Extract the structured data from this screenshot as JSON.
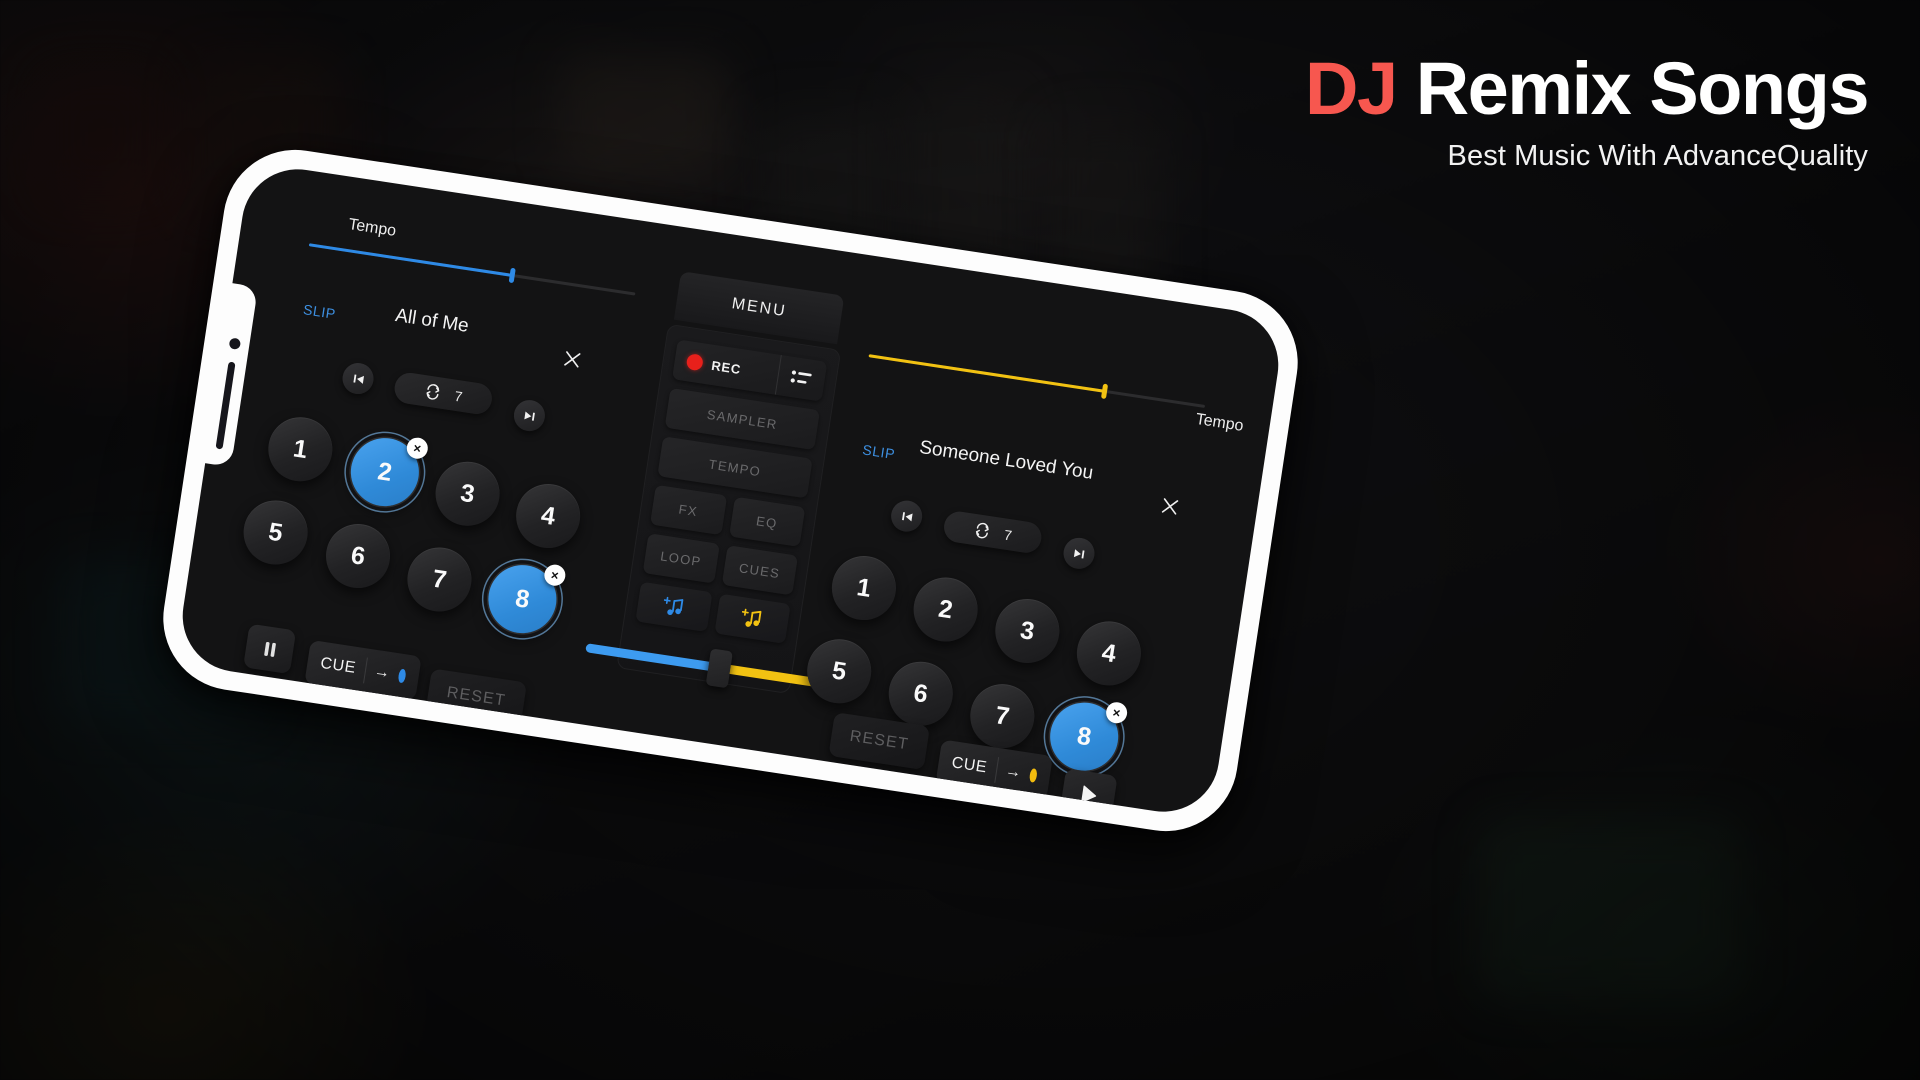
{
  "title": {
    "accent_word": "DJ",
    "main_rest": " Remix Songs",
    "subtitle": "Best Music With AdvanceQuality",
    "accent_color": "#f7574f"
  },
  "colors": {
    "deck_a": "#2e8ae6",
    "deck_b": "#f2c212",
    "rec": "#e8201b",
    "pad_active": "#3d93e2"
  },
  "deck_a": {
    "tempo_label": "Tempo",
    "slip_label": "SLIP",
    "track_title": "All of Me",
    "close_icon": "close-icon",
    "prev_icon": "skip-previous-icon",
    "next_icon": "skip-next-icon",
    "loop_icon": "repeat-icon",
    "loop_count": "7",
    "pads": [
      {
        "label": "1",
        "active": false
      },
      {
        "label": "2",
        "active": true
      },
      {
        "label": "3",
        "active": false
      },
      {
        "label": "4",
        "active": false
      },
      {
        "label": "5",
        "active": false
      },
      {
        "label": "6",
        "active": false
      },
      {
        "label": "7",
        "active": false
      },
      {
        "label": "8",
        "active": true
      }
    ],
    "pad_clear_badge": "×",
    "play_state_icon": "pause-icon",
    "cue_label": "CUE",
    "cue_arrow": "→",
    "reset_label": "RESET",
    "tempo_value_pct": 62
  },
  "deck_b": {
    "tempo_label": "Tempo",
    "slip_label": "SLIP",
    "track_title": "Someone Loved You",
    "close_icon": "close-icon",
    "prev_icon": "skip-previous-icon",
    "next_icon": "skip-next-icon",
    "loop_icon": "repeat-icon",
    "loop_count": "7",
    "pads": [
      {
        "label": "1",
        "active": false
      },
      {
        "label": "2",
        "active": false
      },
      {
        "label": "3",
        "active": false
      },
      {
        "label": "4",
        "active": false
      },
      {
        "label": "5",
        "active": false
      },
      {
        "label": "6",
        "active": false
      },
      {
        "label": "7",
        "active": false
      },
      {
        "label": "8",
        "active": true
      }
    ],
    "pad_clear_badge": "×",
    "play_state_icon": "play-icon",
    "cue_label": "CUE",
    "cue_arrow": "→",
    "reset_label": "RESET",
    "tempo_value_pct": 70
  },
  "menu": {
    "tab_label": "MENU",
    "rec_label": "REC",
    "rec_list_icon": "playlist-icon",
    "buttons": [
      "SAMPLER",
      "TEMPO",
      "FX",
      "EQ",
      "LOOP",
      "CUES"
    ],
    "sampler_label": "SAMPLER",
    "tempo_label": "TEMPO",
    "fx_label": "FX",
    "eq_label": "EQ",
    "loop_label": "LOOP",
    "cues_label": "CUES",
    "note_a_icon": "add-music-note-blue-icon",
    "note_b_icon": "add-music-note-yellow-icon"
  },
  "crossfader": {
    "position_pct": 50,
    "left_color": "#3d9bf0",
    "right_color": "#f2c212"
  }
}
